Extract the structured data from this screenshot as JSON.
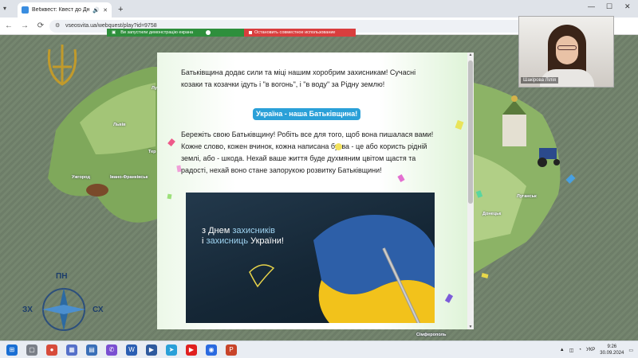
{
  "browser": {
    "tab_title": "Вебквест: Квест до Дня за...",
    "url": "vseosvita.ua/webquest/play?id=9758",
    "new_tab": "+",
    "minimize": "—",
    "maximize": "☐",
    "close": "✕"
  },
  "share_banner": {
    "active_text": "Ви запустили демонстрацію екрана",
    "stop_text": "Остановить совместное использование"
  },
  "video": {
    "participant_name": "Шакірова Лілія"
  },
  "content": {
    "paragraph1": "Батьківщина додає сили та міці нашим хоробрим захисникам! Сучасні козаки та козачки ідуть і \"в вогонь\", і \"в воду\" за Рідну землю!",
    "heading": "Україна - наша Батьківщина!",
    "paragraph2": "Бережіть свою Батьківщину! Робіть все для того, щоб вона пишалася вами! Кожне слово, кожен вчинок, кожна написана буква - це або користь рідній землі, або - шкода. Нехай ваше життя буде духмяним цвітом щастя та радості, нехай воно стане запорукою розвитку Батьківщини!",
    "poster_line1_a": "з Днем ",
    "poster_line1_b": "захисників",
    "poster_line2_a": "і ",
    "poster_line2_b": "захисниць",
    "poster_line2_c": " України!"
  },
  "map_labels": {
    "lviv": "Львів",
    "uzhhorod": "Ужгород",
    "ivano_frankivsk": "Івано-Франківськ",
    "luhansk": "Луганськ",
    "donetsk": "Донецьк",
    "simferopol": "Сімферополь",
    "ter": "Тер",
    "lu": "Лу"
  },
  "compass": {
    "north": "ПН",
    "west": "ЗХ",
    "east": "СХ"
  },
  "taskbar": {
    "language": "УКР",
    "time": "9:26",
    "date": "30.09.2024"
  },
  "colors": {
    "heading_bg": "#2aa0d8",
    "share_on": "#2e8f3c",
    "share_stop": "#d93e3e"
  }
}
